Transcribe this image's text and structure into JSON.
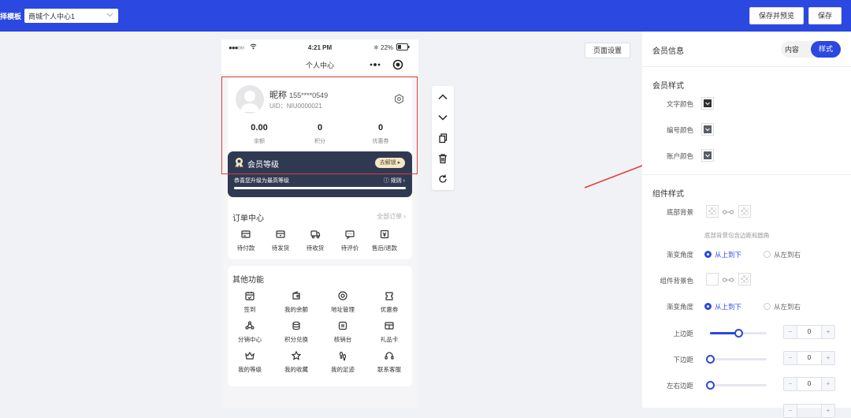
{
  "topbar": {
    "template_label": "择模板",
    "template_value": "商城个人中心1",
    "save_preview_label": "保存并预览",
    "save_label": "保存"
  },
  "page_settings_label": "页面设置",
  "phone": {
    "status": {
      "carrier": "●●●○○",
      "time": "4:21 PM",
      "battery": "22%"
    },
    "nav_title": "个人中心",
    "profile": {
      "nickname": "昵称",
      "phone": "155****0549",
      "uid": "UID：NIU0000021"
    },
    "stats": [
      {
        "value": "0.00",
        "label": "余额"
      },
      {
        "value": "0",
        "label": "积分"
      },
      {
        "value": "0",
        "label": "优惠券"
      }
    ],
    "vip": {
      "title": "会员等级",
      "button": "去解锁",
      "subtitle": "恭喜您升级为最高等级",
      "rule": "规则",
      "progress": 1.0
    },
    "orders": {
      "title": "订单中心",
      "more": "全部订单",
      "items": [
        {
          "label": "待付款",
          "icon": "wallet-card-icon"
        },
        {
          "label": "待发货",
          "icon": "box-icon"
        },
        {
          "label": "待收货",
          "icon": "truck-icon"
        },
        {
          "label": "待评价",
          "icon": "comment-icon"
        },
        {
          "label": "售后/退款",
          "icon": "refund-icon"
        }
      ]
    },
    "functions": {
      "title": "其他功能",
      "items": [
        {
          "label": "签到",
          "icon": "calendar-check-icon"
        },
        {
          "label": "我的余额",
          "icon": "wallet-icon"
        },
        {
          "label": "地址管理",
          "icon": "location-icon"
        },
        {
          "label": "优惠券",
          "icon": "ticket-icon"
        },
        {
          "label": "分销中心",
          "icon": "share-icon"
        },
        {
          "label": "积分兑换",
          "icon": "coins-icon"
        },
        {
          "label": "核销台",
          "icon": "verify-icon"
        },
        {
          "label": "礼品卡",
          "icon": "gift-card-icon"
        },
        {
          "label": "我的等级",
          "icon": "crown-icon"
        },
        {
          "label": "我的收藏",
          "icon": "star-icon"
        },
        {
          "label": "我的足迹",
          "icon": "footprint-icon"
        },
        {
          "label": "联系客服",
          "icon": "headset-icon"
        }
      ]
    }
  },
  "toolbar_icons": [
    "arrow-up-icon",
    "arrow-down-icon",
    "copy-icon",
    "trash-icon",
    "reset-icon"
  ],
  "panel": {
    "title": "会员信息",
    "tab_content": "内容",
    "tab_style": "样式",
    "member_style": {
      "heading": "会员样式",
      "text_color_label": "文字颜色",
      "text_color": "#303133",
      "number_color_label": "编号颜色",
      "number_color": "#5a5e66",
      "account_color_label": "账户颜色",
      "account_color": "#5a5e66"
    },
    "component_style": {
      "heading": "组件样式",
      "bottom_bg_label": "底部背景",
      "bottom_bg_hint": "底部背景包含边距和圆角",
      "gradient_label": "渐变角度",
      "opt_top_bottom": "从上到下",
      "opt_left_right": "从左到右",
      "component_bg_label": "组件背景色",
      "gradient2_label": "渐变角度",
      "margin_top_label": "上边距",
      "margin_top": 0,
      "margin_top_slider": 0.5,
      "margin_bottom_label": "下边距",
      "margin_bottom": 0,
      "margin_bottom_slider": 0,
      "margin_lr_label": "左右边距",
      "margin_lr": 0,
      "margin_lr_slider": 0
    }
  },
  "colors": {
    "accent": "#2b48e0",
    "highlight": "#e53935",
    "vip_card": "#2f3a52"
  }
}
